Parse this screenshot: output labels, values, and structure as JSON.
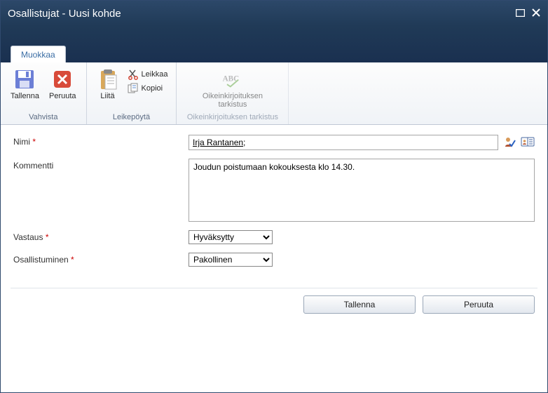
{
  "window": {
    "title": "Osallistujat - Uusi kohde"
  },
  "tabs": {
    "edit": "Muokkaa"
  },
  "ribbon": {
    "confirm_group": "Vahvista",
    "clipboard_group": "Leikepöytä",
    "spell_group": "Oikeinkirjoituksen tarkistus",
    "save": "Tallenna",
    "cancel": "Peruuta",
    "paste": "Liitä",
    "cut": "Leikkaa",
    "copy": "Kopioi",
    "spellcheck": "Oikeinkirjoituksen\ntarkistus"
  },
  "form": {
    "name_label": "Nimi",
    "name_value": "Irja Rantanen",
    "name_suffix": " ;",
    "comment_label": "Kommentti",
    "comment_value": "Joudun poistumaan kokouksesta klo 14.30.",
    "response_label": "Vastaus",
    "response_value": "Hyväksytty",
    "response_options": [
      "Hyväksytty"
    ],
    "participation_label": "Osallistuminen",
    "participation_value": "Pakollinen",
    "participation_options": [
      "Pakollinen"
    ]
  },
  "buttons": {
    "save": "Tallenna",
    "cancel": "Peruuta"
  }
}
